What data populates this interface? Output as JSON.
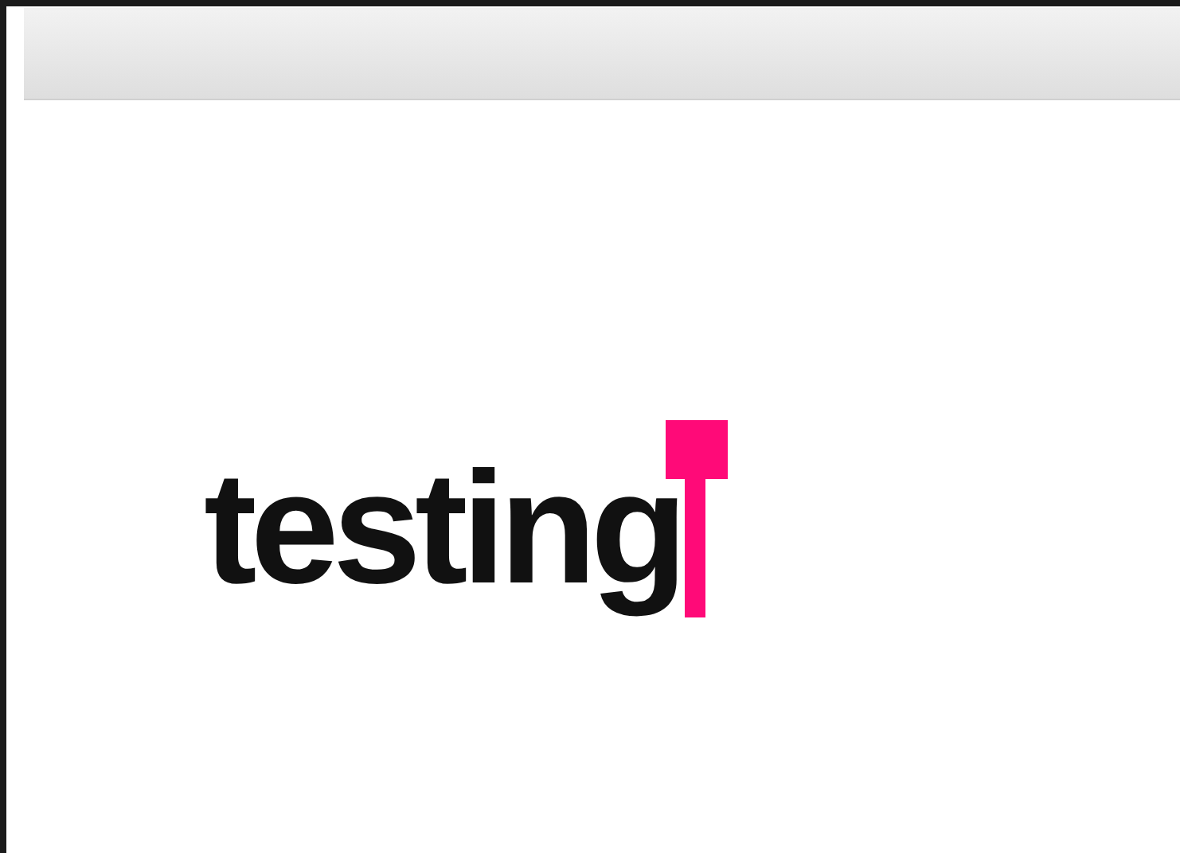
{
  "editor": {
    "text": "testing"
  }
}
